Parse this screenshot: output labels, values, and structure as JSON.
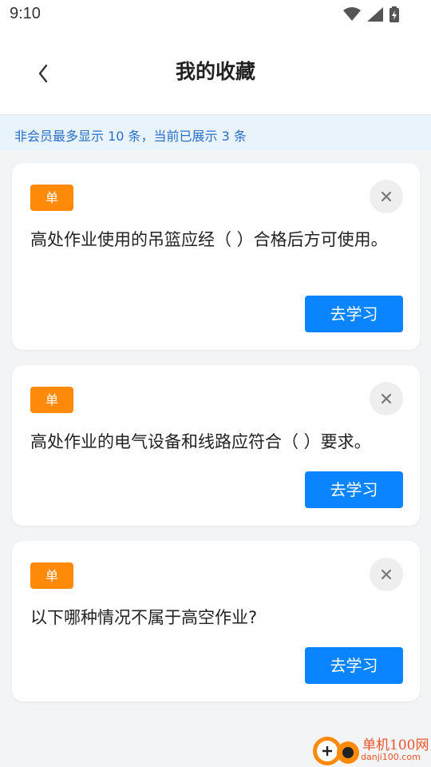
{
  "status_bar": {
    "time": "9:10"
  },
  "header": {
    "title": "我的收藏",
    "back_icon": "chevron-left-icon"
  },
  "notice": {
    "text": "非会员最多显示 10 条，当前已展示 3 条"
  },
  "favorites": [
    {
      "type_badge": "单",
      "question": "高处作业使用的吊篮应经（ ）合格后方可使用。",
      "action_label": "去学习"
    },
    {
      "type_badge": "单",
      "question": "高处作业的电气设备和线路应符合（ ）要求。",
      "action_label": "去学习"
    },
    {
      "type_badge": "单",
      "question": "以下哪种情况不属于高空作业?",
      "action_label": "去学习"
    }
  ],
  "watermark": {
    "name": "单机100网",
    "domain": "danji100.com"
  },
  "colors": {
    "accent": "#0a84ff",
    "badge": "#ff8a0a",
    "notice_text": "#2a6fc9",
    "notice_bg": "#e8f3fb"
  }
}
